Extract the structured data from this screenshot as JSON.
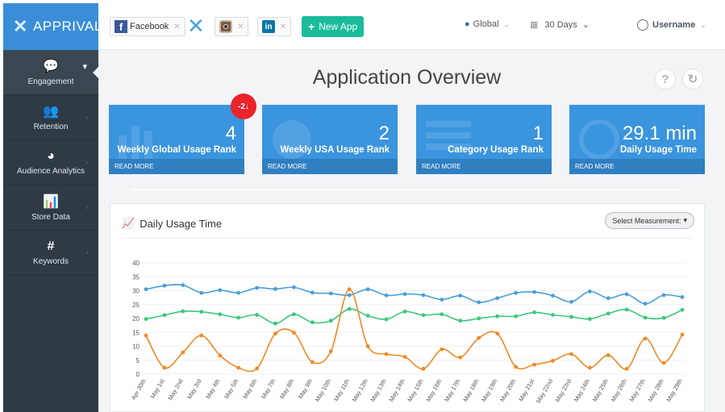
{
  "brand": {
    "name": "APPRIVAL",
    "icon": "x-logo-icon"
  },
  "sidebar": {
    "items": [
      {
        "label": "Engagement",
        "icon": "chat-bubble-icon",
        "glyph": "💬",
        "active": true
      },
      {
        "label": "Retention",
        "icon": "users-icon",
        "glyph": "👥",
        "active": false
      },
      {
        "label": "Audience Analytics",
        "icon": "pie-chart-icon",
        "glyph": "◕",
        "active": false
      },
      {
        "label": "Store Data",
        "icon": "bar-chart-icon",
        "glyph": "📊",
        "active": false
      },
      {
        "label": "Keywords",
        "icon": "hashtag-icon",
        "glyph": "#",
        "active": false
      }
    ]
  },
  "topbar": {
    "apps": [
      {
        "label": "Facebook",
        "icon": "facebook-icon"
      },
      {
        "label": "",
        "icon": "x-app-icon"
      },
      {
        "label": "",
        "icon": "instagram-icon"
      },
      {
        "label": "",
        "icon": "linkedin-icon"
      }
    ],
    "new_app_label": "New App",
    "region": "Global",
    "period": "30 Days",
    "user": "Username"
  },
  "page": {
    "title": "Application Overview",
    "help_glyph": "?",
    "refresh_glyph": "↻"
  },
  "cards": [
    {
      "value": "4",
      "label": "Weekly Global Usage Rank",
      "more": "READ MORE",
      "badge": "-2"
    },
    {
      "value": "2",
      "label": "Weekly USA Usage Rank",
      "more": "READ MORE"
    },
    {
      "value": "1",
      "label": "Category Usage Rank",
      "more": "READ MORE"
    },
    {
      "value": "29.1 min",
      "label": "Daily Usage Time",
      "more": "READ MORE"
    }
  ],
  "panel": {
    "title": "Daily Usage Time",
    "measure_label": "Select Measurement:"
  },
  "chart_data": {
    "type": "line",
    "title": "Daily Usage Time",
    "x": [
      "Apr 30th",
      "May 1st",
      "May 2nd",
      "May 3rd",
      "May 4th",
      "May 5th",
      "May 6th",
      "May 7th",
      "May 8th",
      "May 9th",
      "May 10th",
      "May 11th",
      "May 12th",
      "May 13th",
      "May 14th",
      "May 15th",
      "May 16th",
      "May 17th",
      "May 18th",
      "May 19th",
      "May 20th",
      "May 21st",
      "May 22nd",
      "May 23rd",
      "May 24th",
      "May 25th",
      "May 26th",
      "May 27th",
      "May 28th",
      "May 29th"
    ],
    "ylim": [
      0,
      40
    ],
    "yticks": [
      0,
      5,
      10,
      15,
      20,
      25,
      30,
      35,
      40
    ],
    "series": [
      {
        "color": "#4a9fd8",
        "values": [
          30.5,
          31.8,
          32,
          29.2,
          30.2,
          29.2,
          31,
          30.6,
          31.2,
          29.3,
          29,
          28.4,
          30.5,
          28.3,
          28.8,
          28.4,
          26.8,
          28.2,
          25.8,
          27.3,
          29.2,
          29.5,
          28.2,
          26,
          29.7,
          27.3,
          28.7,
          25.3,
          28.4,
          27.7
        ]
      },
      {
        "color": "#3cc77b",
        "values": [
          19.8,
          21.2,
          22.6,
          22.4,
          21.5,
          20.3,
          21.3,
          18.2,
          21.5,
          18.6,
          19.2,
          23.4,
          21,
          19.7,
          22.5,
          21.2,
          21.5,
          19.2,
          20,
          20.8,
          20.8,
          22.2,
          21.3,
          20.6,
          19.8,
          21.8,
          23.2,
          20.3,
          20.2,
          23.1
        ]
      },
      {
        "color": "#f08a24",
        "values": [
          13.9,
          2.3,
          7.8,
          13.9,
          6.7,
          2.3,
          2,
          14.6,
          14.9,
          4.3,
          8.2,
          30.5,
          10,
          7.2,
          6.2,
          1.9,
          8.9,
          6,
          13,
          14.6,
          2.6,
          3.4,
          4.8,
          7.2,
          2.3,
          6.8,
          1.9,
          12.8,
          4,
          14.2
        ]
      }
    ]
  }
}
